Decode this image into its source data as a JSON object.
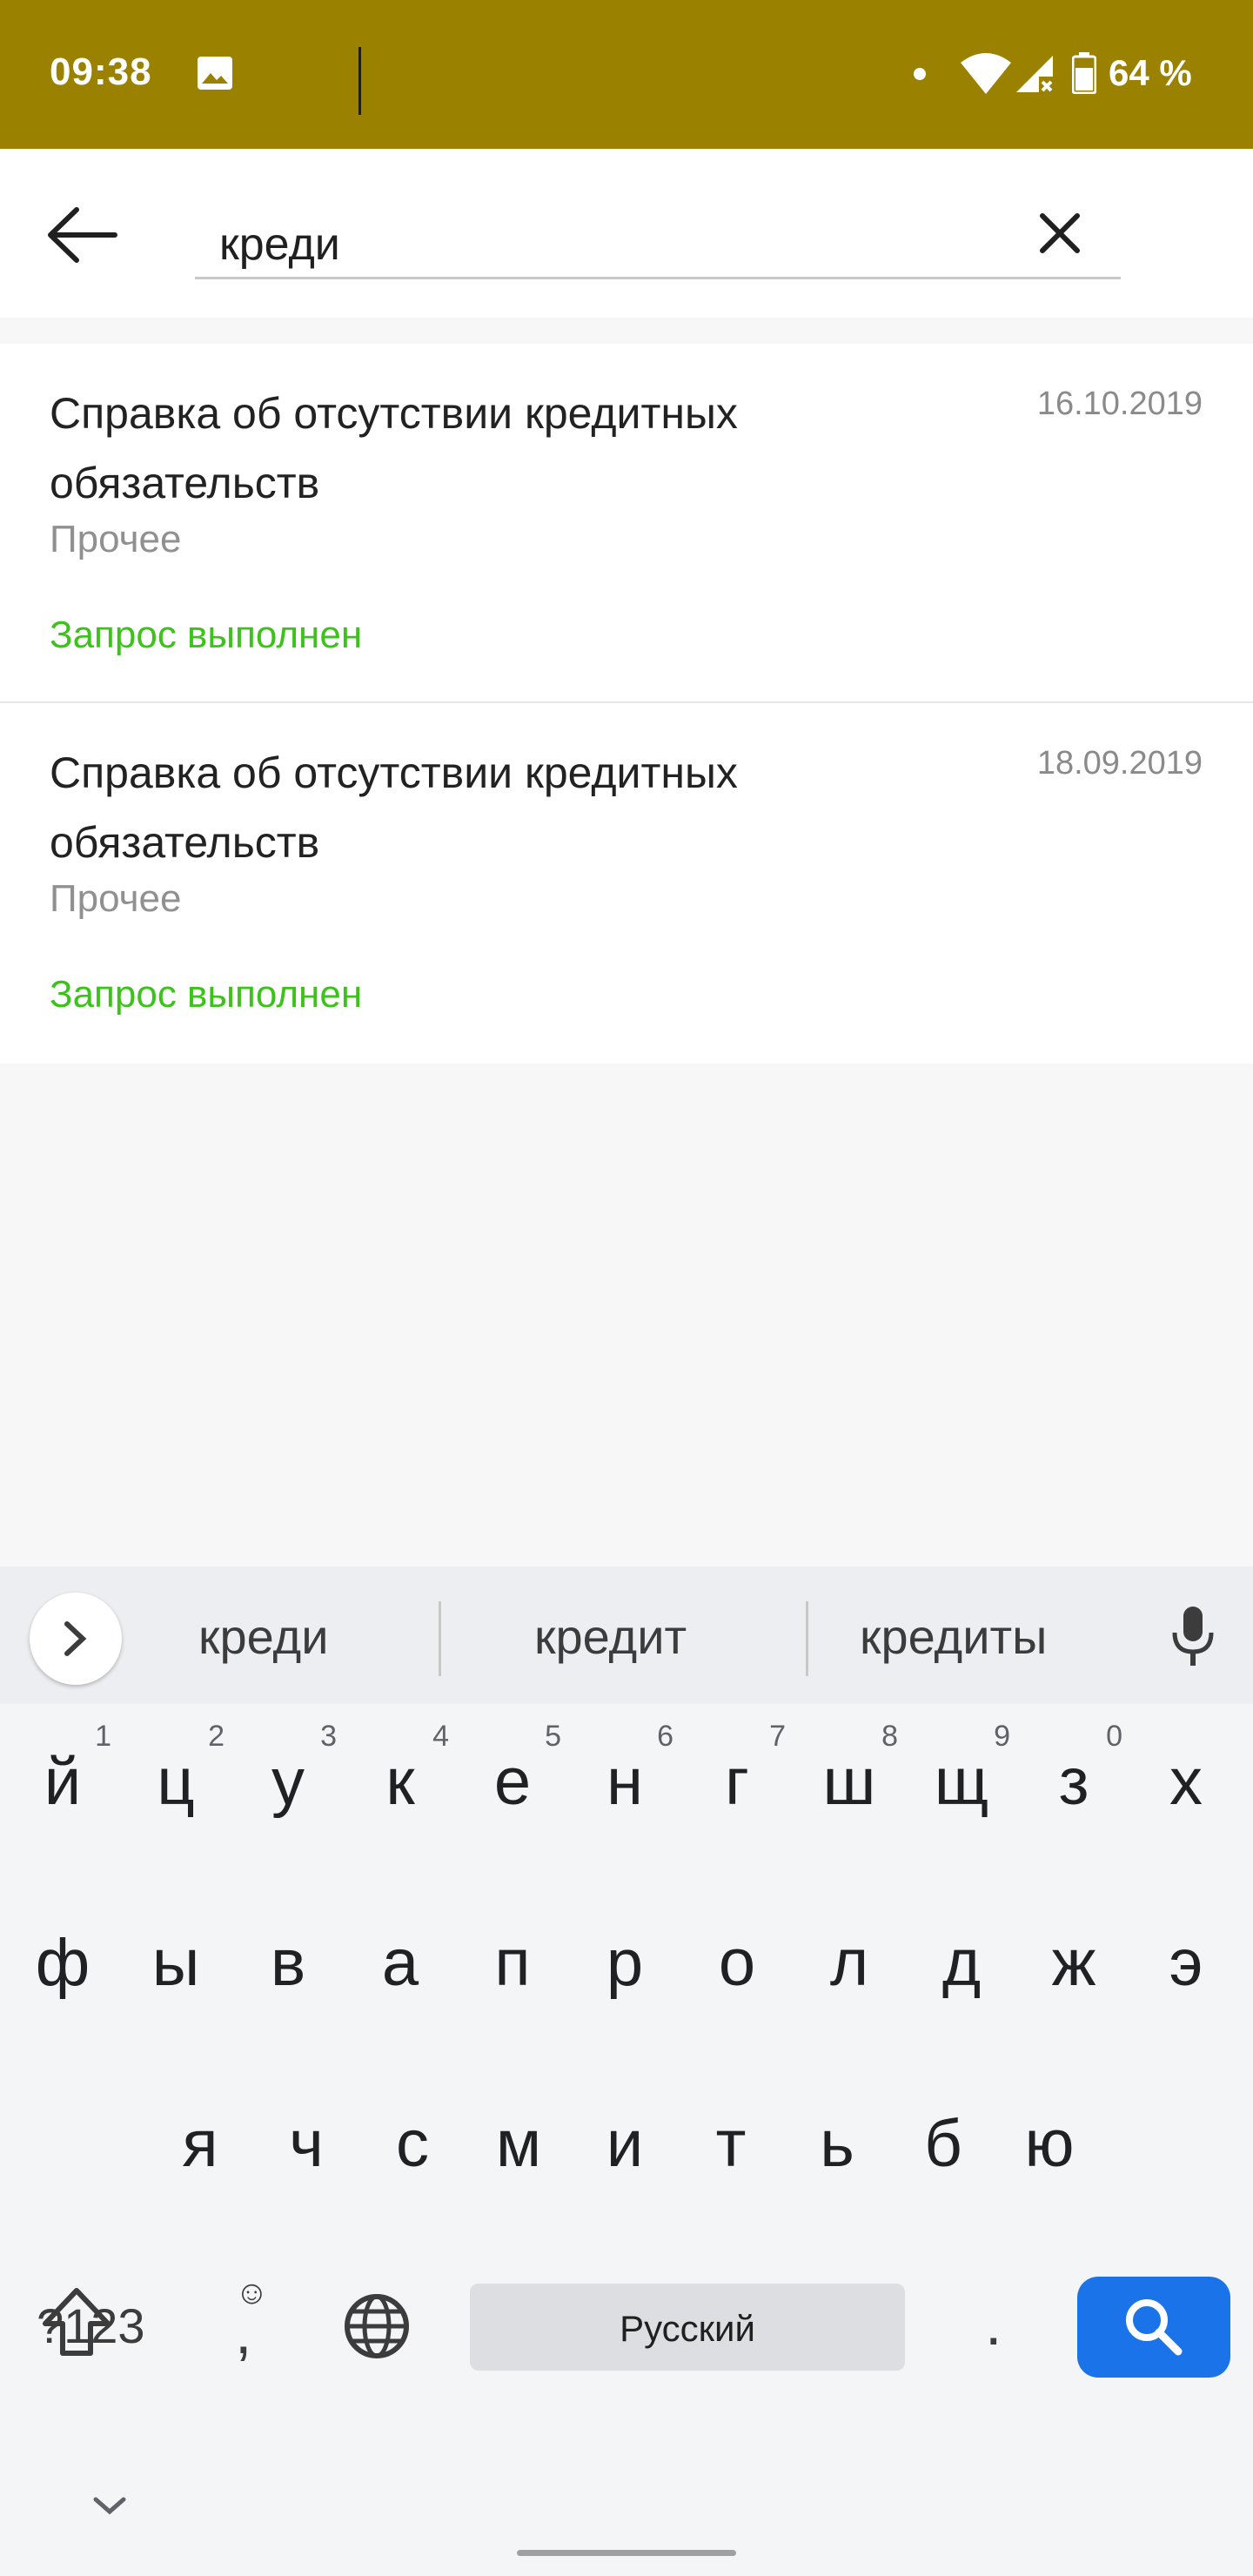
{
  "status_bar": {
    "time": "09:38",
    "battery": "64 %"
  },
  "search": {
    "query": "креди"
  },
  "results": [
    {
      "title": "Справка об отсутствии кредитных обязательств",
      "date": "16.10.2019",
      "category": "Прочее",
      "status": "Запрос выполнен"
    },
    {
      "title": "Справка об отсутствии кредитных обязательств",
      "date": "18.09.2019",
      "category": "Прочее",
      "status": "Запрос выполнен"
    }
  ],
  "colors": {
    "status_bar": "#9a8200",
    "success": "#3cc21a",
    "accent": "#1a73e8"
  },
  "keyboard": {
    "suggestions": [
      "креди",
      "кредит",
      "кредиты"
    ],
    "row1": [
      "й",
      "ц",
      "у",
      "к",
      "е",
      "н",
      "г",
      "ш",
      "щ",
      "з",
      "х"
    ],
    "row1_hints": [
      "1",
      "2",
      "3",
      "4",
      "5",
      "6",
      "7",
      "8",
      "9",
      "0"
    ],
    "row2": [
      "ф",
      "ы",
      "в",
      "а",
      "п",
      "р",
      "о",
      "л",
      "д",
      "ж",
      "э"
    ],
    "row3": [
      "я",
      "ч",
      "с",
      "м",
      "и",
      "т",
      "ь",
      "б",
      "ю"
    ],
    "symbols_key": "?123",
    "emoji_hint": "☺",
    "comma": ",",
    "space_label": "Русский",
    "period": ".",
    "icons": [
      "shift-icon",
      "backspace-icon",
      "globe-icon",
      "search-icon",
      "mic-icon",
      "chevron-right-icon",
      "chevron-down-icon"
    ]
  }
}
